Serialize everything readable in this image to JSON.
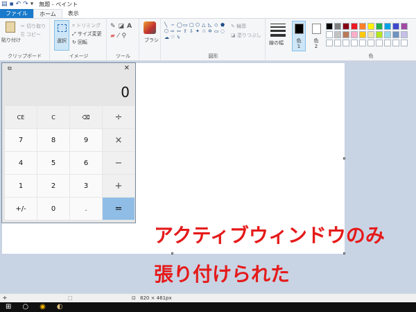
{
  "titlebar": {
    "title": "無題 - ペイント",
    "icons": [
      "paint-icon",
      "save-icon",
      "undo-icon",
      "redo-icon",
      "customize-icon"
    ]
  },
  "tabs": [
    {
      "label": "ファイル"
    },
    {
      "label": "ホーム"
    },
    {
      "label": "表示"
    }
  ],
  "ribbon": {
    "clipboard": {
      "label": "クリップボード",
      "paste": "貼り付け",
      "cut": "切り取り",
      "copy": "コピー"
    },
    "image": {
      "label": "イメージ",
      "select": "選択",
      "crop": "トリミング",
      "resize": "サイズ変更",
      "rotate": "回転"
    },
    "tools": {
      "label": "ツール"
    },
    "brushes": {
      "label": "ブラシ"
    },
    "shapes": {
      "label": "図形",
      "outline": "輪郭",
      "fill": "塗りつぶし"
    },
    "size": {
      "label": "線の幅"
    },
    "color1": {
      "label": "色\n1"
    },
    "color2": {
      "label": "色\n2"
    },
    "colors": {
      "label": "色"
    },
    "palette": [
      "#000000",
      "#7f7f7f",
      "#880015",
      "#ed1c24",
      "#ff7f27",
      "#fff200",
      "#22b14c",
      "#00a2e8",
      "#3f48cc",
      "#a349a4",
      "#ffffff",
      "#c3c3c3",
      "#b97a57",
      "#ffaec9",
      "#ffc90e",
      "#efe4b0",
      "#b5e61d",
      "#99d9ea",
      "#7092be",
      "#c8bfe7",
      "#ffffff",
      "#ffffff",
      "#ffffff",
      "#ffffff",
      "#ffffff",
      "#ffffff",
      "#ffffff",
      "#ffffff",
      "#ffffff",
      "#ffffff"
    ],
    "color1_value": "#000000",
    "color2_value": "#ffffff"
  },
  "calculator": {
    "display": "0",
    "keys": [
      "CE",
      "C",
      "⌫",
      "÷",
      "7",
      "8",
      "9",
      "×",
      "4",
      "5",
      "6",
      "−",
      "1",
      "2",
      "3",
      "+",
      "+/-",
      "0",
      ".",
      "="
    ]
  },
  "annotation": {
    "line1": "アクティブウィンドウのみ",
    "line2": "張り付けられた"
  },
  "status": {
    "canvas_size": "820 × 461px"
  }
}
